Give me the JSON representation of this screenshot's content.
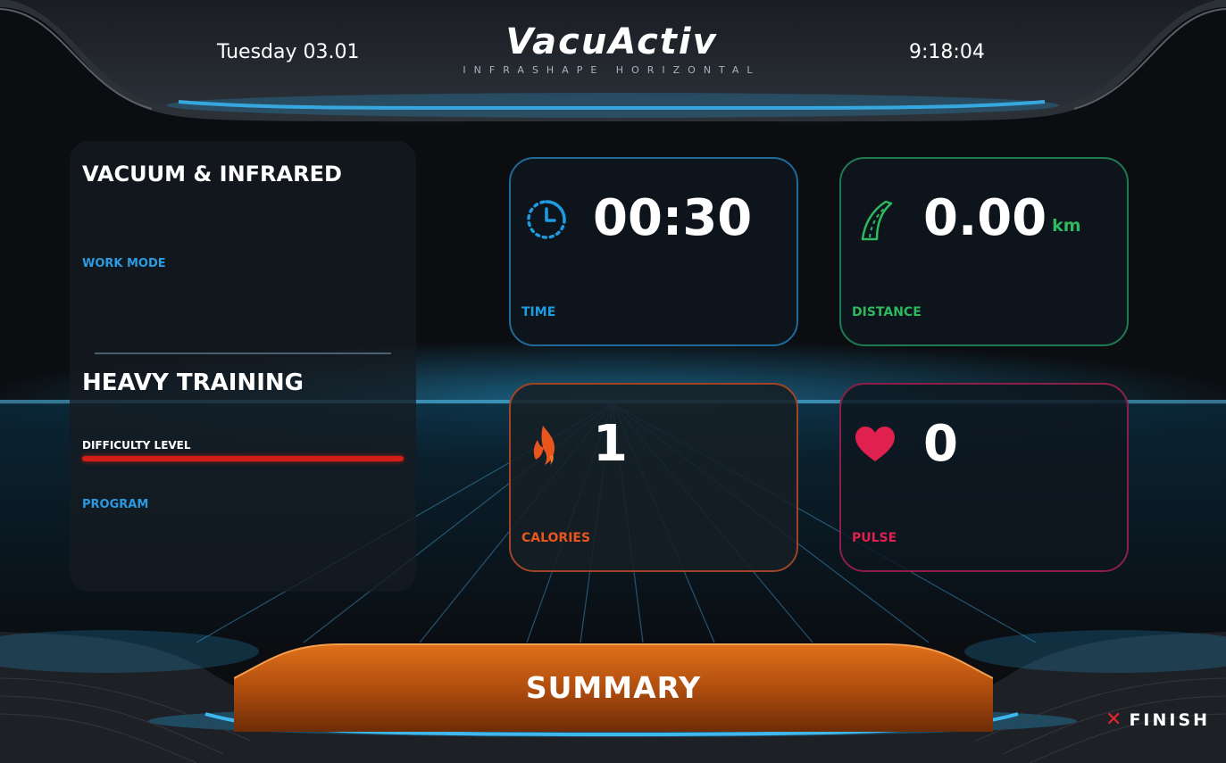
{
  "header": {
    "date": "Tuesday 03.01",
    "time": "9:18:04",
    "brand_name": "VacuActiv",
    "brand_subtitle": "INFRASHAPE HORIZONTAL"
  },
  "left_panel": {
    "mode_title": "VACUUM & INFRARED",
    "mode_label": "WORK MODE",
    "program_title": "HEAVY TRAINING",
    "difficulty_label": "DIFFICULTY LEVEL",
    "difficulty_fill": 1.0,
    "program_label": "PROGRAM"
  },
  "cards": {
    "time": {
      "value": "00:30",
      "label": "TIME",
      "color": "#1e9be0",
      "icon": "clock-icon"
    },
    "distance": {
      "value": "0.00",
      "unit": "km",
      "label": "DISTANCE",
      "color": "#2fb85e",
      "icon": "road-icon"
    },
    "calories": {
      "value": "1",
      "label": "CALORIES",
      "color": "#e8561e",
      "icon": "flame-icon"
    },
    "pulse": {
      "value": "0",
      "label": "PULSE",
      "color": "#e0204e",
      "icon": "heart-icon"
    }
  },
  "actions": {
    "summary_label": "SUMMARY",
    "finish_label": "FINISH",
    "finish_icon": "close-icon"
  },
  "colors": {
    "accent_blue": "#1e9be0",
    "accent_orange": "#d2620e",
    "difficulty_red": "#d01e16"
  }
}
